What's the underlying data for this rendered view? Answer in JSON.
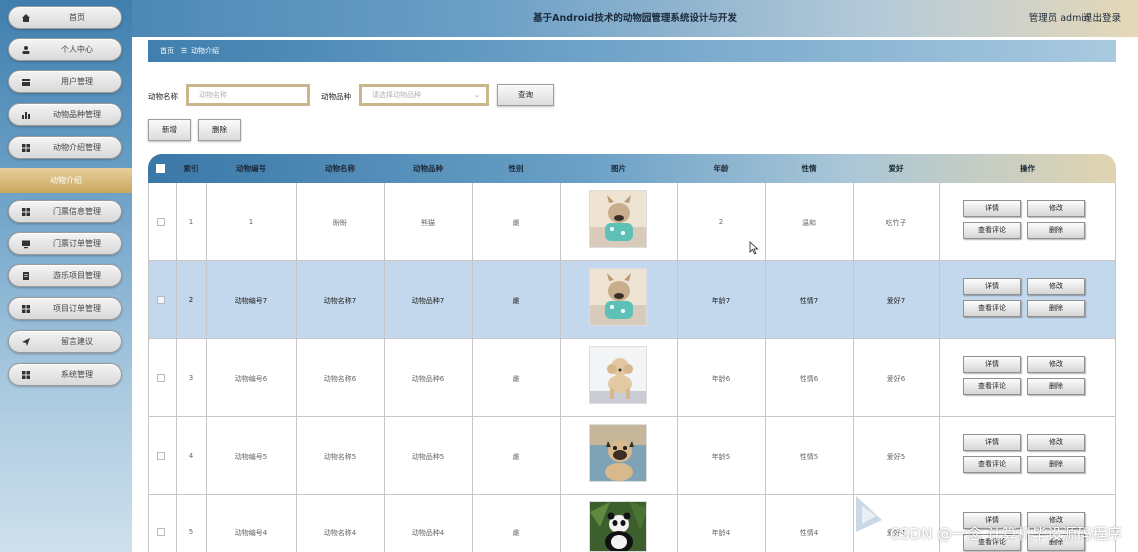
{
  "header": {
    "title": "基于Android技术的动物园管理系统设计与开发",
    "user": "管理员 admin",
    "logout": "退出登录"
  },
  "sidebar": {
    "items": [
      {
        "label": "首页",
        "icon": "home-icon"
      },
      {
        "label": "个人中心",
        "icon": "user-icon"
      },
      {
        "label": "用户管理",
        "icon": "users-icon"
      },
      {
        "label": "动物品种管理",
        "icon": "bar-chart-icon"
      },
      {
        "label": "动物介绍管理",
        "icon": "grid-icon"
      },
      {
        "label": "门票信息管理",
        "icon": "grid-icon"
      },
      {
        "label": "门票订单管理",
        "icon": "monitor-icon"
      },
      {
        "label": "游乐项目管理",
        "icon": "document-icon"
      },
      {
        "label": "项目订单管理",
        "icon": "grid-icon"
      },
      {
        "label": "留言建议",
        "icon": "send-icon"
      },
      {
        "label": "系统管理",
        "icon": "grid-icon"
      }
    ],
    "active_sub": "动物介绍"
  },
  "breadcrumb": {
    "home": "首页",
    "sep": "☰",
    "current": "动物介绍"
  },
  "search": {
    "name_label": "动物名称",
    "name_placeholder": "动物名称",
    "breed_label": "动物品种",
    "breed_placeholder": "请选择动物品种",
    "query": "查询"
  },
  "actions": {
    "add": "新增",
    "delete": "删除"
  },
  "table": {
    "headers": [
      "索引",
      "动物编号",
      "动物名称",
      "动物品种",
      "性别",
      "图片",
      "年龄",
      "性情",
      "爱好",
      "操作"
    ],
    "rows": [
      {
        "index": "1",
        "code": "1",
        "name": "盼盼",
        "breed": "熊猫",
        "gender": "雌",
        "age": "2",
        "temper": "温和",
        "hobby": "吃竹子",
        "photo": "frenchie-icon",
        "selected": false
      },
      {
        "index": "2",
        "code": "动物编号7",
        "name": "动物名称7",
        "breed": "动物品种7",
        "gender": "雌",
        "age": "年龄7",
        "temper": "性情7",
        "hobby": "爱好7",
        "photo": "frenchie-icon",
        "selected": true
      },
      {
        "index": "3",
        "code": "动物编号6",
        "name": "动物名称6",
        "breed": "动物品种6",
        "gender": "雌",
        "age": "年龄6",
        "temper": "性情6",
        "hobby": "爱好6",
        "photo": "poodle-icon",
        "selected": false
      },
      {
        "index": "4",
        "code": "动物编号5",
        "name": "动物名称5",
        "breed": "动物品种5",
        "gender": "雌",
        "age": "年龄5",
        "temper": "性情5",
        "hobby": "爱好5",
        "photo": "pug-icon",
        "selected": false
      },
      {
        "index": "5",
        "code": "动物编号4",
        "name": "动物名称4",
        "breed": "动物品种4",
        "gender": "雌",
        "age": "年龄4",
        "temper": "性情4",
        "hobby": "爱好4",
        "photo": "panda-icon",
        "selected": false
      }
    ],
    "row_actions": {
      "detail": "详情",
      "edit": "修改",
      "comments": "查看评论",
      "remove": "删除"
    }
  },
  "watermark": "CSDN @一念 计算机毕设源码程序",
  "colors": {
    "accent_gold": "#c9a65c",
    "primary_blue": "#3f7fae",
    "selected_row": "#c3d8ec"
  }
}
